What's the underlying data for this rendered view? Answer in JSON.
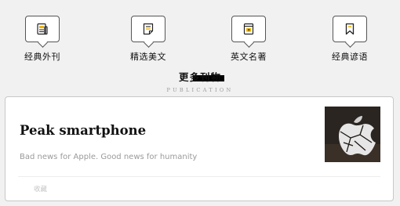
{
  "categories": [
    {
      "icon": "newspaper-icon",
      "label": "经典外刊"
    },
    {
      "icon": "article-icon",
      "label": "精选美文"
    },
    {
      "icon": "book-icon",
      "label": "英文名著"
    },
    {
      "icon": "bookmark-icon",
      "label": "经典谚语"
    }
  ],
  "section": {
    "title": "更多刊物",
    "subtitle": "PUBLICATION"
  },
  "article": {
    "title": "Peak smartphone",
    "description": "Bad news for Apple. Good news for humanity",
    "action_label": "收藏",
    "thumbnail": "cracked-apple-logo-image"
  }
}
